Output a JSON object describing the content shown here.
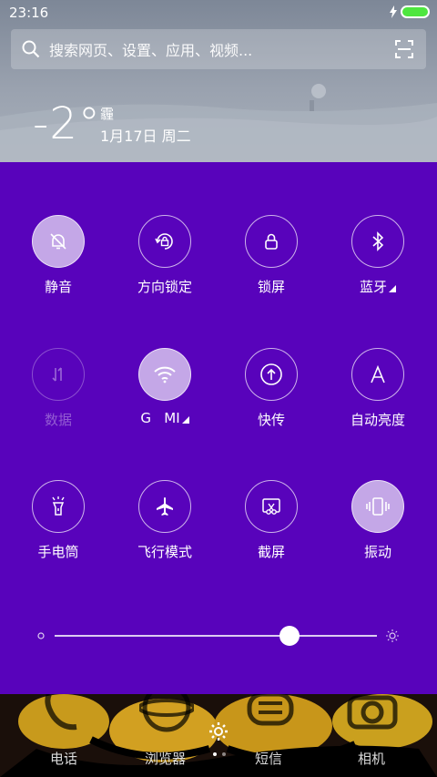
{
  "status": {
    "time": "23:16"
  },
  "search": {
    "placeholder": "搜索网页、设置、应用、视频..."
  },
  "weather": {
    "temperature": "-2°",
    "condition": "霾",
    "date": "1月17日 周二"
  },
  "toggles": [
    {
      "label": "静音",
      "icon": "bell-off-icon",
      "state": "on"
    },
    {
      "label": "方向锁定",
      "icon": "rotation-lock-icon",
      "state": "off"
    },
    {
      "label": "锁屏",
      "icon": "lock-icon",
      "state": "off"
    },
    {
      "label": "蓝牙",
      "icon": "bluetooth-icon",
      "state": "off"
    },
    {
      "label": "数据",
      "icon": "mobile-data-icon",
      "state": "disabled"
    },
    {
      "label": "G   MI",
      "icon": "wifi-icon",
      "state": "on"
    },
    {
      "label": "快传",
      "icon": "upload-icon",
      "state": "off"
    },
    {
      "label": "自动亮度",
      "icon": "auto-brightness-icon",
      "state": "off"
    },
    {
      "label": "手电筒",
      "icon": "flashlight-icon",
      "state": "off"
    },
    {
      "label": "飞行模式",
      "icon": "airplane-icon",
      "state": "off"
    },
    {
      "label": "截屏",
      "icon": "screenshot-icon",
      "state": "off"
    },
    {
      "label": "振动",
      "icon": "vibrate-icon",
      "state": "on"
    }
  ],
  "brightness": {
    "level": 0.73
  },
  "dock": {
    "labels": [
      "电话",
      "浏览器",
      "短信",
      "相机"
    ]
  },
  "colors": {
    "panel": "#5803bb",
    "battery": "#4ee63f"
  }
}
